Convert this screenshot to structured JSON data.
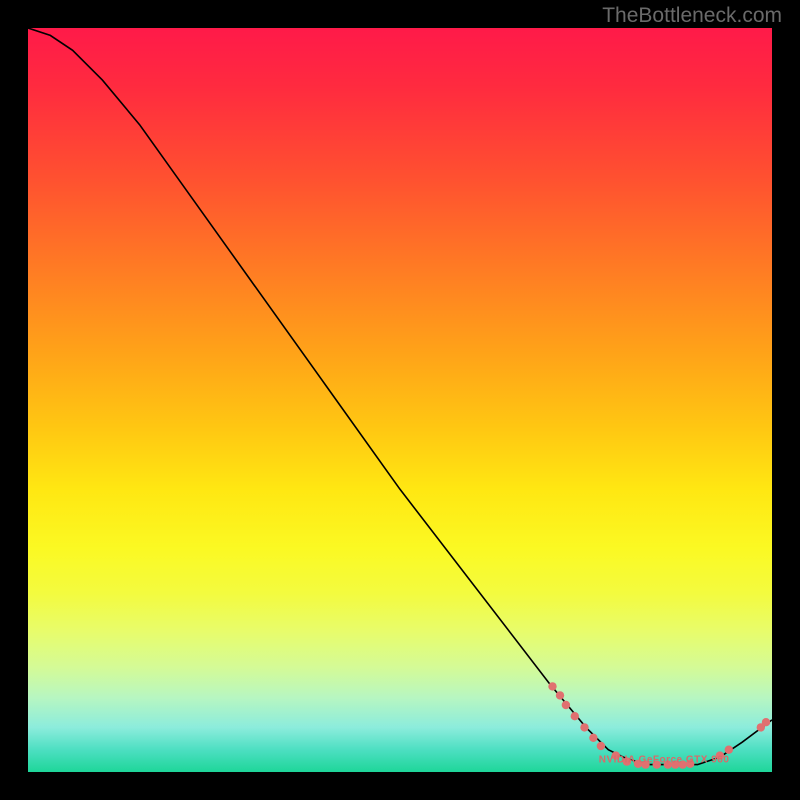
{
  "watermark": "TheBottleneck.com",
  "chart_data": {
    "type": "line",
    "title": "",
    "xlabel": "",
    "ylabel": "",
    "xlim": [
      0,
      100
    ],
    "ylim": [
      0,
      100
    ],
    "series": [
      {
        "name": "curve",
        "x": [
          0,
          3,
          6,
          10,
          15,
          20,
          30,
          40,
          50,
          60,
          70,
          75,
          78,
          80,
          83,
          86,
          90,
          93,
          96,
          100
        ],
        "y": [
          100,
          99,
          97,
          93,
          87,
          80,
          66,
          52,
          38,
          25,
          12,
          6,
          3,
          2,
          1,
          1,
          1,
          2,
          4,
          7
        ]
      }
    ],
    "dots": [
      {
        "x": 70.5,
        "y": 11.5
      },
      {
        "x": 71.5,
        "y": 10.3
      },
      {
        "x": 72.3,
        "y": 9.0
      },
      {
        "x": 73.5,
        "y": 7.5
      },
      {
        "x": 74.8,
        "y": 6.0
      },
      {
        "x": 76.0,
        "y": 4.6
      },
      {
        "x": 77.0,
        "y": 3.5
      },
      {
        "x": 79.0,
        "y": 2.2
      },
      {
        "x": 80.5,
        "y": 1.4
      },
      {
        "x": 82.0,
        "y": 1.1
      },
      {
        "x": 83.0,
        "y": 1.0
      },
      {
        "x": 84.5,
        "y": 1.0
      },
      {
        "x": 86.0,
        "y": 1.0
      },
      {
        "x": 87.0,
        "y": 1.0
      },
      {
        "x": 88.0,
        "y": 1.0
      },
      {
        "x": 89.0,
        "y": 1.1
      },
      {
        "x": 93.0,
        "y": 2.2
      },
      {
        "x": 94.2,
        "y": 3.0
      },
      {
        "x": 98.5,
        "y": 6.0
      },
      {
        "x": 99.2,
        "y": 6.7
      }
    ],
    "annotation": {
      "text": "NVIDIA GeForce GTX 960",
      "x": 85.5,
      "y": 1.0
    },
    "gradient_colors": {
      "top": "#ff1a49",
      "mid": "#ffe712",
      "bottom": "#1ed699"
    }
  }
}
